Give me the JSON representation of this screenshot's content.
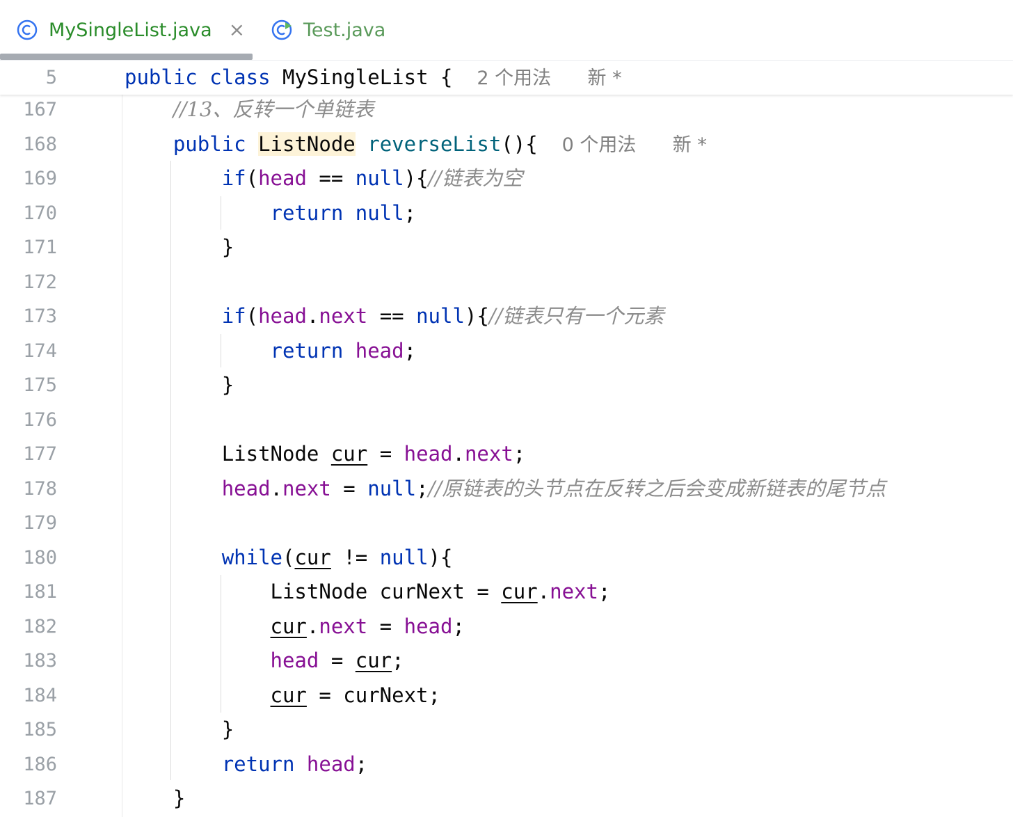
{
  "tabs": [
    {
      "label": "MySingleList.java",
      "active": true,
      "close": "×",
      "color": "#2a8c2a"
    },
    {
      "label": "Test.java",
      "active": false,
      "color": "#5a9a5a"
    }
  ],
  "sticky_line": {
    "number": "5",
    "kw1": "public",
    "kw2": "class",
    "name": "MySingleList",
    "brace": "{",
    "usage": "2 个用法",
    "new": "新 *"
  },
  "lines": {
    "l167": {
      "num": "167",
      "comment": "//13、反转一个单链表"
    },
    "l168": {
      "num": "168",
      "kw": "public",
      "type": "ListNode",
      "method": "reverseList",
      "rest": "(){",
      "usage": "0 个用法",
      "new": "新 *"
    },
    "l169": {
      "num": "169",
      "kw": "if",
      "p1": "(",
      "head": "head",
      "op": " == ",
      "nul": "null",
      "p2": "){",
      "comment": "//链表为空"
    },
    "l170": {
      "num": "170",
      "kw": "return",
      "nul": "null",
      "end": ";"
    },
    "l171": {
      "num": "171",
      "brace": "}"
    },
    "l172": {
      "num": "172"
    },
    "l173": {
      "num": "173",
      "kw": "if",
      "p1": "(",
      "head": "head",
      "dot": ".",
      "next": "next",
      "op": " == ",
      "nul": "null",
      "p2": "){",
      "comment": "//链表只有一个元素"
    },
    "l174": {
      "num": "174",
      "kw": "return",
      "head": "head",
      "end": ";"
    },
    "l175": {
      "num": "175",
      "brace": "}"
    },
    "l176": {
      "num": "176"
    },
    "l177": {
      "num": "177",
      "type": "ListNode",
      "var": "cur",
      "op": " = ",
      "head": "head",
      "dot": ".",
      "next": "next",
      "end": ";"
    },
    "l178": {
      "num": "178",
      "head": "head",
      "dot": ".",
      "next": "next",
      "op": " = ",
      "nul": "null",
      "end": ";",
      "comment": "//原链表的头节点在反转之后会变成新链表的尾节点"
    },
    "l179": {
      "num": "179"
    },
    "l180": {
      "num": "180",
      "kw": "while",
      "p1": "(",
      "var": "cur",
      "op": " != ",
      "nul": "null",
      "p2": "){"
    },
    "l181": {
      "num": "181",
      "type": "ListNode",
      "var2": "curNext",
      "op": " = ",
      "var": "cur",
      "dot": ".",
      "next": "next",
      "end": ";"
    },
    "l182": {
      "num": "182",
      "var": "cur",
      "dot": ".",
      "next": "next",
      "op": " = ",
      "head": "head",
      "end": ";"
    },
    "l183": {
      "num": "183",
      "head": "head",
      "op": " = ",
      "var": "cur",
      "end": ";"
    },
    "l184": {
      "num": "184",
      "var": "cur",
      "op": " = ",
      "var2": "curNext",
      "end": ";"
    },
    "l185": {
      "num": "185",
      "brace": "}"
    },
    "l186": {
      "num": "186",
      "kw": "return",
      "head": "head",
      "end": ";"
    },
    "l187": {
      "num": "187",
      "brace": "}"
    }
  }
}
